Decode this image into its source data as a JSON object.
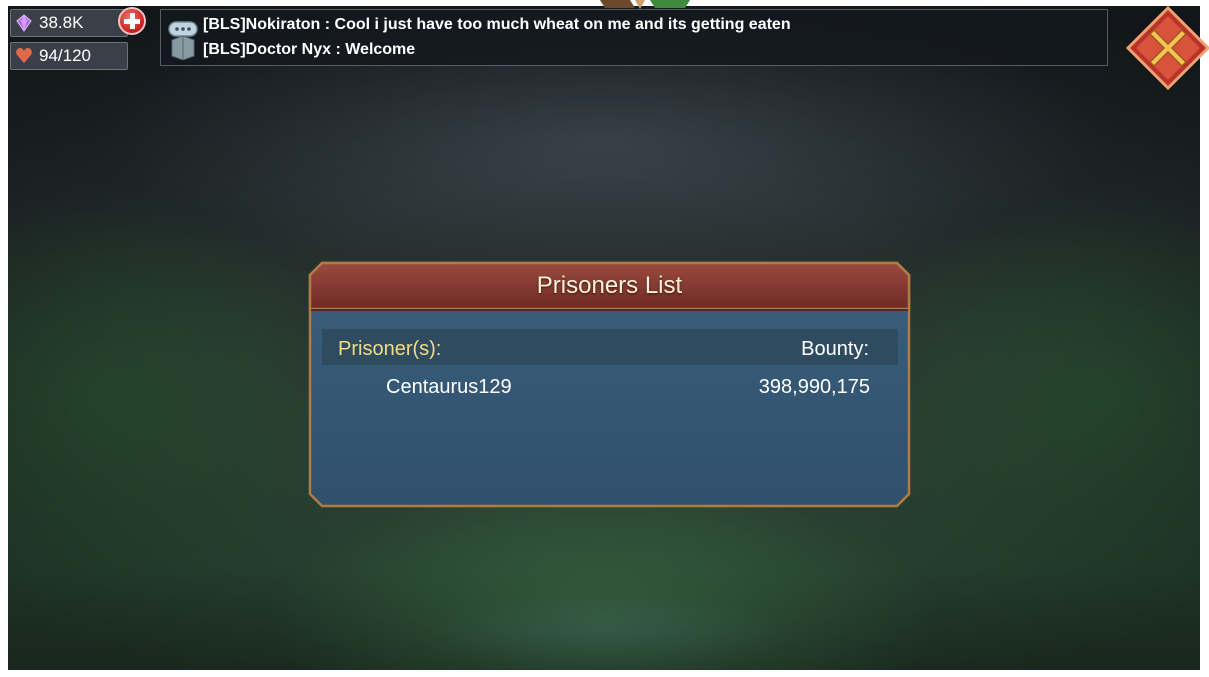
{
  "resources": {
    "gems": "38.8K",
    "stamina": "94/120"
  },
  "chat": {
    "messages": [
      "[BLS]Nokiraton : Cool i just have too much wheat on me and its getting eaten",
      "[BLS]Doctor Nyx : Welcome"
    ]
  },
  "icons": {
    "gems": "gem-icon",
    "stamina": "heart-icon",
    "add": "plus-icon",
    "chat": "chat-bubble-icon",
    "close": "close-icon"
  },
  "colors": {
    "title_bar": "#8a3a32",
    "panel_body": "#355774",
    "panel_border": "#b07c45",
    "prisoner_header": "#f1dc86",
    "close_button": "#d94a3a"
  },
  "panel": {
    "title": "Prisoners List",
    "columns": {
      "prisoner": "Prisoner(s):",
      "bounty": "Bounty:"
    },
    "rows": [
      {
        "name": "Centaurus129",
        "bounty": "398,990,175"
      }
    ]
  }
}
